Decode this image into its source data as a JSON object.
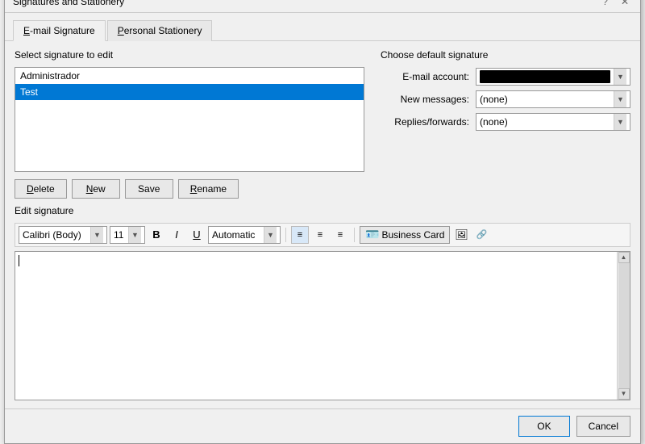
{
  "dialog": {
    "title": "Signatures and Stationery",
    "help_btn": "?",
    "close_btn": "✕"
  },
  "tabs": {
    "email_sig": "E-mail Signature",
    "personal_stat": "Personal Stationery"
  },
  "signature_section": {
    "label": "Select signature to edit",
    "items": [
      {
        "name": "Administrador",
        "selected": false
      },
      {
        "name": "Test",
        "selected": true
      }
    ]
  },
  "buttons": {
    "delete": "Delete",
    "new": "New",
    "save": "Save",
    "rename": "Rename"
  },
  "default_sig": {
    "title": "Choose default signature",
    "email_account_label": "E-mail account:",
    "new_messages_label": "New messages:",
    "replies_label": "Replies/forwards:",
    "new_messages_value": "(none)",
    "replies_value": "(none)"
  },
  "edit_section": {
    "label": "Edit signature",
    "font": "Calibri (Body)",
    "font_size": "11",
    "bold": "B",
    "italic": "I",
    "underline": "U",
    "color": "Automatic",
    "business_card_label": "Business Card"
  },
  "footer": {
    "ok": "OK",
    "cancel": "Cancel"
  }
}
